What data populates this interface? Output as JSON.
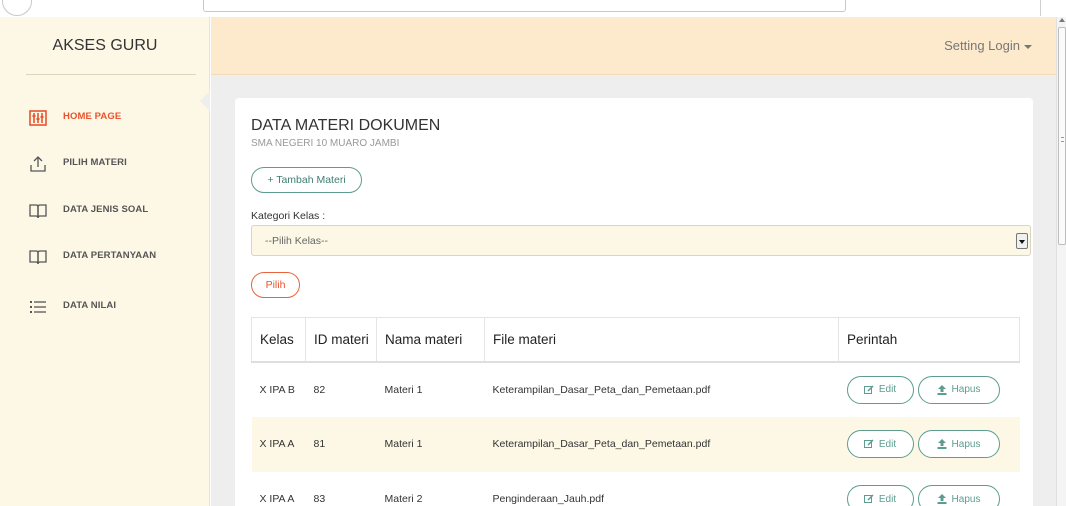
{
  "sidebar": {
    "brand": "AKSES GURU",
    "items": [
      {
        "label": "HOME PAGE",
        "icon": "home-grid-icon",
        "active": true
      },
      {
        "label": "PILIH MATERI",
        "icon": "upload-icon",
        "active": false
      },
      {
        "label": "DATA JENIS SOAL",
        "icon": "book-icon",
        "active": false
      },
      {
        "label": "DATA PERTANYAAN",
        "icon": "book-icon",
        "active": false
      },
      {
        "label": "DATA NILAI",
        "icon": "list-icon",
        "active": false
      }
    ]
  },
  "header": {
    "setting_label": "Setting Login"
  },
  "panel": {
    "title": "DATA MATERI DOKUMEN",
    "subtitle": "SMA NEGERI 10 MUARO JAMBI",
    "add_button": "+ Tambah Materi",
    "kategori_label": "Kategori Kelas :",
    "select_value": "--Pilih Kelas--",
    "pilih_button": "Pilih"
  },
  "table": {
    "headers": [
      "Kelas",
      "ID materi",
      "Nama materi",
      "File materi",
      "Perintah"
    ],
    "rows": [
      {
        "kelas": "X IPA B",
        "id": "82",
        "nama": "Materi 1",
        "file": "Keterampilan_Dasar_Peta_dan_Pemetaan.pdf",
        "edit": "Edit",
        "hapus": "Hapus"
      },
      {
        "kelas": "X IPA A",
        "id": "81",
        "nama": "Materi 1",
        "file": "Keterampilan_Dasar_Peta_dan_Pemetaan.pdf",
        "edit": "Edit",
        "hapus": "Hapus"
      },
      {
        "kelas": "X IPA A",
        "id": "83",
        "nama": "Materi 2",
        "file": "Penginderaan_Jauh.pdf",
        "edit": "Edit",
        "hapus": "Hapus"
      }
    ]
  },
  "colors": {
    "accent": "#e8532d",
    "teal": "#5c9d8f",
    "header_bg": "#fde9cc",
    "sidebar_bg": "#fdf8e6"
  }
}
